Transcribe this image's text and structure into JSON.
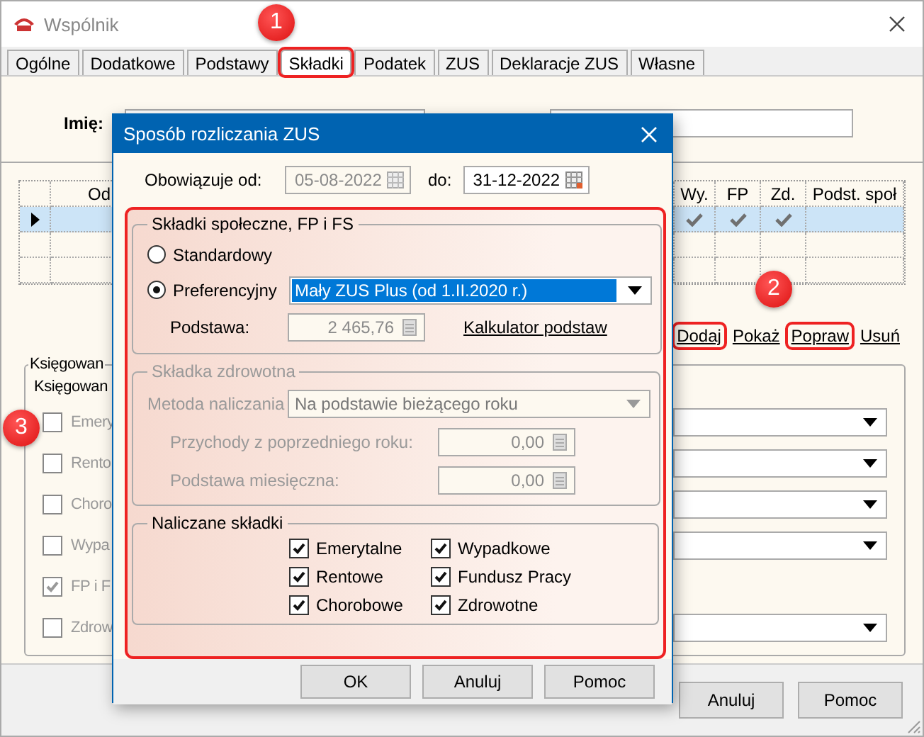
{
  "window": {
    "title": "Wspólnik"
  },
  "tabs": [
    {
      "label": "Ogólne",
      "selected": false,
      "highlighted": false
    },
    {
      "label": "Dodatkowe",
      "selected": false,
      "highlighted": false
    },
    {
      "label": "Podstawy",
      "selected": false,
      "highlighted": false
    },
    {
      "label": "Składki",
      "selected": true,
      "highlighted": true
    },
    {
      "label": "Podatek",
      "selected": false,
      "highlighted": false
    },
    {
      "label": "ZUS",
      "selected": false,
      "highlighted": false
    },
    {
      "label": "Deklaracje ZUS",
      "selected": false,
      "highlighted": false
    },
    {
      "label": "Własne",
      "selected": false,
      "highlighted": false
    }
  ],
  "form": {
    "name_label": "Imię:"
  },
  "grid": {
    "columns": [
      "Od",
      "Wy.",
      "FP",
      "Zd.",
      "Podst. społ"
    ],
    "rows": [
      {
        "selected": true,
        "checks": [
          true,
          true,
          true
        ]
      },
      {
        "selected": false,
        "checks": [
          false,
          false,
          false
        ]
      },
      {
        "selected": false,
        "checks": [
          false,
          false,
          false
        ]
      }
    ]
  },
  "links": [
    {
      "label": "Dodaj",
      "highlighted": true
    },
    {
      "label": "Pokaż",
      "highlighted": false
    },
    {
      "label": "Popraw",
      "highlighted": true
    },
    {
      "label": "Usuń",
      "highlighted": false
    }
  ],
  "posting": {
    "group_title": "Księgowan",
    "label": "Księgowan",
    "items": [
      {
        "kind": "select",
        "label": "Emery",
        "checked": false
      },
      {
        "kind": "select",
        "label": "Rento",
        "checked": false
      },
      {
        "kind": "select",
        "label": "Choro",
        "checked": false
      },
      {
        "kind": "select",
        "label": "Wypa",
        "checked": false
      },
      {
        "kind": "plain",
        "label": "FP i F",
        "checked": true
      },
      {
        "kind": "select",
        "label": "Zdrow",
        "checked": false
      }
    ]
  },
  "buttons": [
    "Anuluj",
    "Pomoc"
  ],
  "dialog": {
    "title": "Sposób rozliczania ZUS",
    "from_label": "Obowiązuje od:",
    "from_value": "05-08-2022",
    "from_disabled": true,
    "to_label": "do:",
    "to_value": "31-12-2022",
    "social": {
      "title": "Składki społeczne, FP i FS",
      "options": [
        {
          "label": "Standardowy",
          "selected": false
        },
        {
          "label": "Preferencyjny",
          "selected": true
        }
      ],
      "scheme": "Mały ZUS Plus (od 1.II.2020 r.)",
      "base_label": "Podstawa:",
      "base_value": "2 465,76",
      "calculator_link": "Kalkulator podstaw"
    },
    "health": {
      "title": "Składka zdrowotna",
      "disabled": true,
      "method_label": "Metoda naliczania",
      "method_value": "Na podstawie bieżącego roku",
      "prev_income_label": "Przychody z poprzedniego roku:",
      "prev_income_value": "0,00",
      "monthly_base_label": "Podstawa miesięczna:",
      "monthly_base_value": "0,00"
    },
    "contributions": {
      "title": "Naliczane składki",
      "items": [
        {
          "label": "Emerytalne",
          "checked": true
        },
        {
          "label": "Wypadkowe",
          "checked": true
        },
        {
          "label": "Rentowe",
          "checked": true
        },
        {
          "label": "Fundusz Pracy",
          "checked": true
        },
        {
          "label": "Chorobowe",
          "checked": true
        },
        {
          "label": "Zdrowotne",
          "checked": true
        }
      ]
    },
    "buttons": [
      "OK",
      "Anuluj",
      "Pomoc"
    ]
  },
  "annotations": [
    {
      "number": "1"
    },
    {
      "number": "2"
    },
    {
      "number": "3"
    }
  ]
}
